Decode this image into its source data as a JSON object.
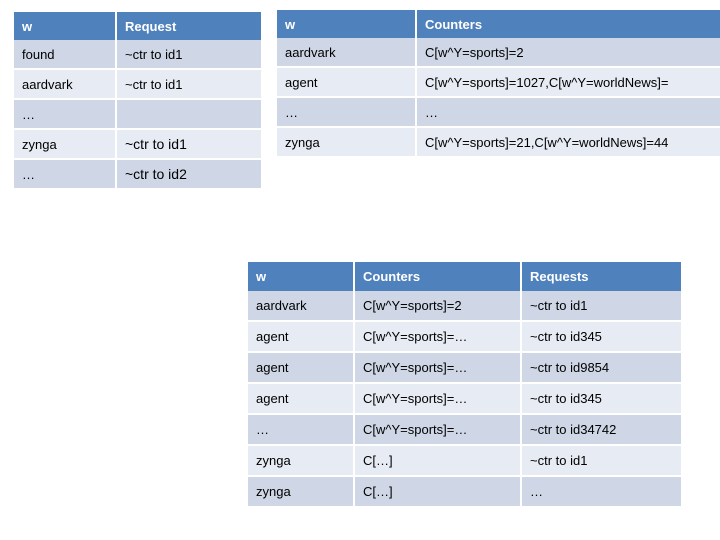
{
  "colors": {
    "header_blue": "#4F81BD",
    "row_dark": "#CFD7E6",
    "row_light": "#E7EBF3",
    "gap_white": "#FFFFFF",
    "text": "#000000",
    "header_text": "#FFFFFF"
  },
  "table_word_request": {
    "headers": [
      "w",
      "Request"
    ],
    "rows": [
      {
        "w": "found",
        "request": "~ctr to id1"
      },
      {
        "w": "aardvark",
        "request": "~ctr to id1"
      },
      {
        "w": "…",
        "request": ""
      },
      {
        "w": "zynga",
        "request": "~ctr to id1"
      },
      {
        "w": "…",
        "request": "~ctr to id2"
      }
    ]
  },
  "table_word_counters": {
    "headers": [
      "w",
      "Counters"
    ],
    "rows": [
      {
        "w": "aardvark",
        "counters": "C[w^Y=sports]=2"
      },
      {
        "w": "agent",
        "counters": "C[w^Y=sports]=1027,C[w^Y=worldNews]="
      },
      {
        "w": "…",
        "counters": "…"
      },
      {
        "w": "zynga",
        "counters": "C[w^Y=sports]=21,C[w^Y=worldNews]=44"
      }
    ]
  },
  "table_word_counters_requests": {
    "headers": [
      "w",
      "Counters",
      "Requests"
    ],
    "rows": [
      {
        "w": "aardvark",
        "counters": "C[w^Y=sports]=2",
        "requests": "~ctr to id1"
      },
      {
        "w": "agent",
        "counters": "C[w^Y=sports]=…",
        "requests": "~ctr to id345"
      },
      {
        "w": "agent",
        "counters": "C[w^Y=sports]=…",
        "requests": "~ctr to id9854"
      },
      {
        "w": "agent",
        "counters": "C[w^Y=sports]=…",
        "requests": "~ctr to id345"
      },
      {
        "w": "…",
        "counters": "C[w^Y=sports]=…",
        "requests": "~ctr to id34742"
      },
      {
        "w": "zynga",
        "counters": "C[…]",
        "requests": "~ctr to id1"
      },
      {
        "w": "zynga",
        "counters": "C[…]",
        "requests": "…"
      }
    ]
  }
}
